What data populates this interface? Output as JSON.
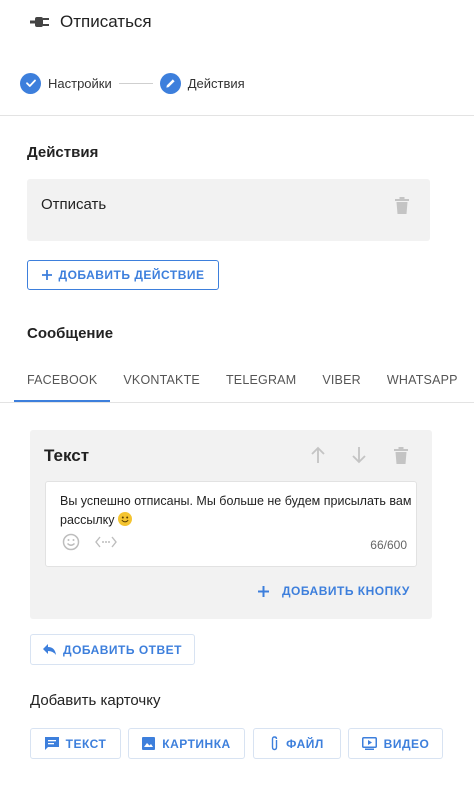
{
  "header": {
    "title": "Отписаться",
    "icon": "plug-icon"
  },
  "stepper": {
    "steps": [
      {
        "label": "Настройки",
        "state": "completed",
        "icon": "check-icon"
      },
      {
        "label": "Действия",
        "state": "active",
        "icon": "pencil-icon"
      }
    ]
  },
  "actions": {
    "title": "Действия",
    "items": [
      {
        "label": "Отписать"
      }
    ],
    "add_label": "ДОБАВИТЬ ДЕЙСТВИЕ"
  },
  "message": {
    "title": "Сообщение",
    "tabs": [
      "FACEBOOK",
      "VKONTAKTE",
      "TELEGRAM",
      "VIBER",
      "WHATSAPP"
    ],
    "active_tab": "FACEBOOK",
    "card": {
      "title": "Текст",
      "text": "Вы успешно отписаны. Мы больше не будем присылать вам рассылку",
      "counter": "66/600",
      "add_button_label": "ДОБАВИТЬ КНОПКУ"
    },
    "add_reply_label": "ДОБАВИТЬ ОТВЕТ"
  },
  "add_card": {
    "title": "Добавить карточку",
    "buttons": [
      {
        "label": "ТЕКСТ",
        "icon": "message-icon"
      },
      {
        "label": "КАРТИНКА",
        "icon": "image-icon"
      },
      {
        "label": "ФАЙЛ",
        "icon": "paperclip-icon"
      },
      {
        "label": "ВИДЕО",
        "icon": "video-icon"
      }
    ]
  },
  "colors": {
    "accent": "#3d7fdc",
    "card_bg": "#f2f2f2",
    "muted_icon": "#c4c4c4"
  }
}
